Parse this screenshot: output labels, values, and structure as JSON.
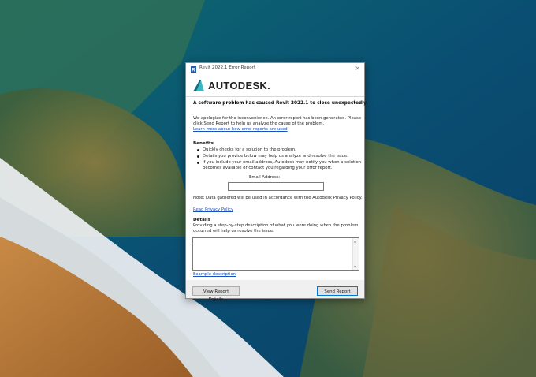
{
  "window": {
    "title": "Revit 2022.1 Error Report",
    "close_glyph": "×"
  },
  "brand": {
    "logo_text": "AUTODESK",
    "logo_dot": "."
  },
  "content": {
    "headline": "A software problem has caused Revit 2022.1 to close unexpectedly.",
    "apology_lines": [
      "We apologize for the inconvenience. An error report has been generated. Please",
      "click Send Report to help us analyze the cause of the problem."
    ],
    "learn_more_link": "Learn more about how error reports are used",
    "benefits_heading": "Benefits",
    "benefits": [
      "Quickly checks for a solution to the problem.",
      "Details you provide below may help us analyze and resolve the issue.",
      "If you include your email address, Autodesk may notify you when a solution",
      "becomes available or contact you regarding your error report."
    ],
    "email_label": "Email Address:",
    "email_value": "",
    "privacy_note": "Note: Data gathered will be used in accordance with the Autodesk Privacy Policy.",
    "privacy_link": "Read Privacy Policy",
    "details_heading": "Details",
    "details_prompt_lines": [
      "Providing a step-by-step description of what you were doing when the problem",
      "occurred will help us resolve the issue:"
    ],
    "details_value": "",
    "example_link": "Example description"
  },
  "buttons": {
    "view_details": "View Report Details",
    "send_report": "Send Report"
  },
  "colors": {
    "link": "#1a4fbf",
    "logo_mark_dark": "#0b6e7a",
    "logo_mark_light": "#38b7c5"
  }
}
